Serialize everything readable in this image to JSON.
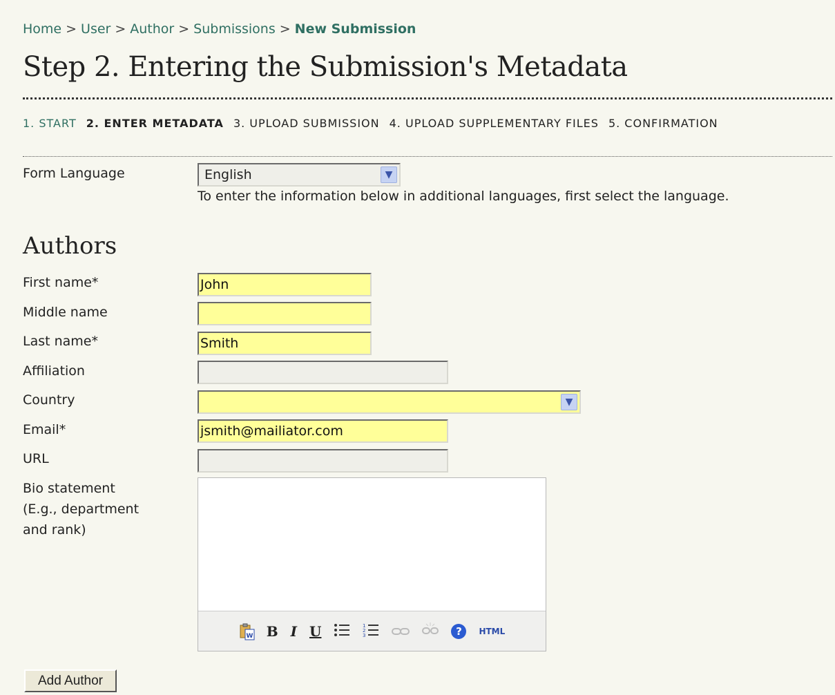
{
  "breadcrumb": {
    "items": [
      "Home",
      "User",
      "Author",
      "Submissions"
    ],
    "separator": ">",
    "current": "New Submission"
  },
  "page_title": "Step 2. Entering the Submission's Metadata",
  "steps": {
    "items": [
      "1. START",
      "2. ENTER METADATA",
      "3. UPLOAD SUBMISSION",
      "4. UPLOAD SUPPLEMENTARY FILES",
      "5. CONFIRMATION"
    ]
  },
  "form_language": {
    "label": "Form Language",
    "value": "English",
    "hint": "To enter the information below in additional languages, first select the language."
  },
  "authors": {
    "heading": "Authors",
    "first_name": {
      "label": "First name*",
      "value": "John"
    },
    "middle_name": {
      "label": "Middle name",
      "value": ""
    },
    "last_name": {
      "label": "Last name*",
      "value": "Smith"
    },
    "affiliation": {
      "label": "Affiliation",
      "value": ""
    },
    "country": {
      "label": "Country",
      "value": ""
    },
    "email": {
      "label": "Email*",
      "value": "jsmith@mailiator.com"
    },
    "url": {
      "label": "URL",
      "value": ""
    },
    "bio": {
      "label_lines": [
        "Bio statement",
        "(E.g., department",
        "and rank)"
      ],
      "value": ""
    },
    "editor_toolbar": {
      "bold": "B",
      "italic": "I",
      "underline": "U",
      "html": "HTML",
      "help": "?"
    },
    "add_author_label": "Add Author"
  },
  "colors": {
    "link": "#2f6f62",
    "required_field_bg": "#ffff99",
    "optional_field_bg": "#efefe9",
    "page_bg": "#f7f7ef"
  }
}
